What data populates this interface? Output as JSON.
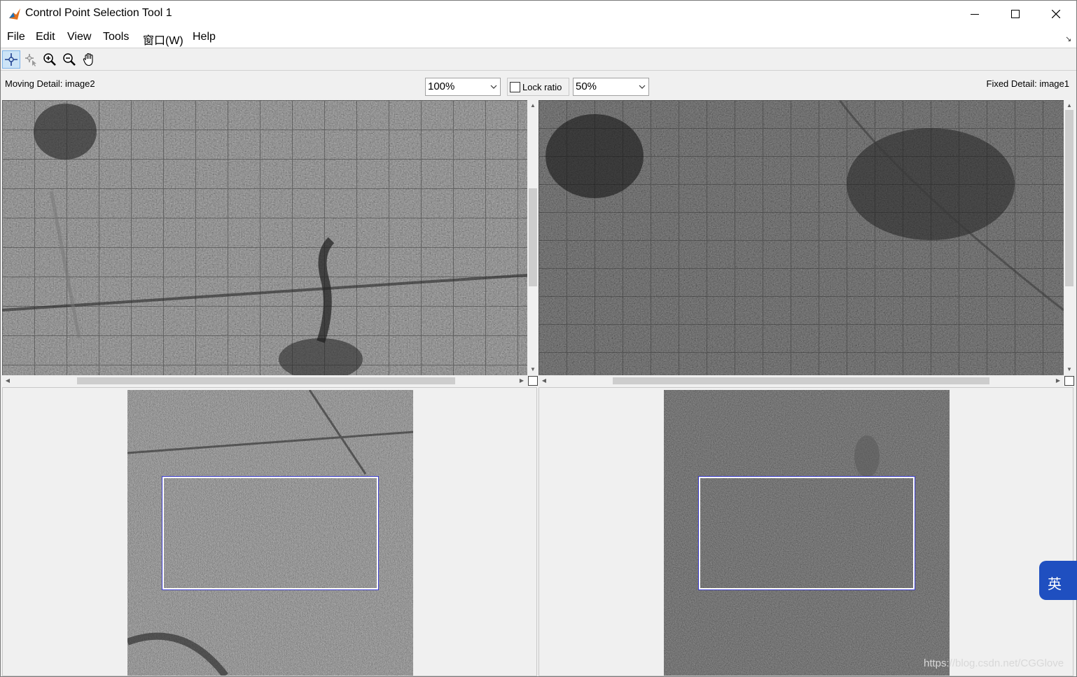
{
  "window": {
    "title": "Control Point Selection Tool 1"
  },
  "menu": [
    "File",
    "Edit",
    "View",
    "Tools",
    "窗口(W)",
    "Help"
  ],
  "toolbar": {
    "tools": [
      "add-point-icon",
      "select-point-icon",
      "zoom-in-icon",
      "zoom-out-icon",
      "pan-hand-icon"
    ],
    "active": "add-point-icon"
  },
  "detail": {
    "moving_label": "Moving Detail: image2",
    "fixed_label": "Fixed Detail: image1",
    "moving_zoom": "100%",
    "lock_ratio_label": "Lock ratio",
    "lock_ratio_checked": false,
    "fixed_zoom": "50%"
  },
  "ime": {
    "label": "英"
  },
  "watermark": "https://blog.csdn.net/CGGlove",
  "colors": {
    "active_tool": "#cce4f7",
    "detail_rect_outline": "#3a3acc",
    "ime_badge": "#1f4fc0"
  }
}
